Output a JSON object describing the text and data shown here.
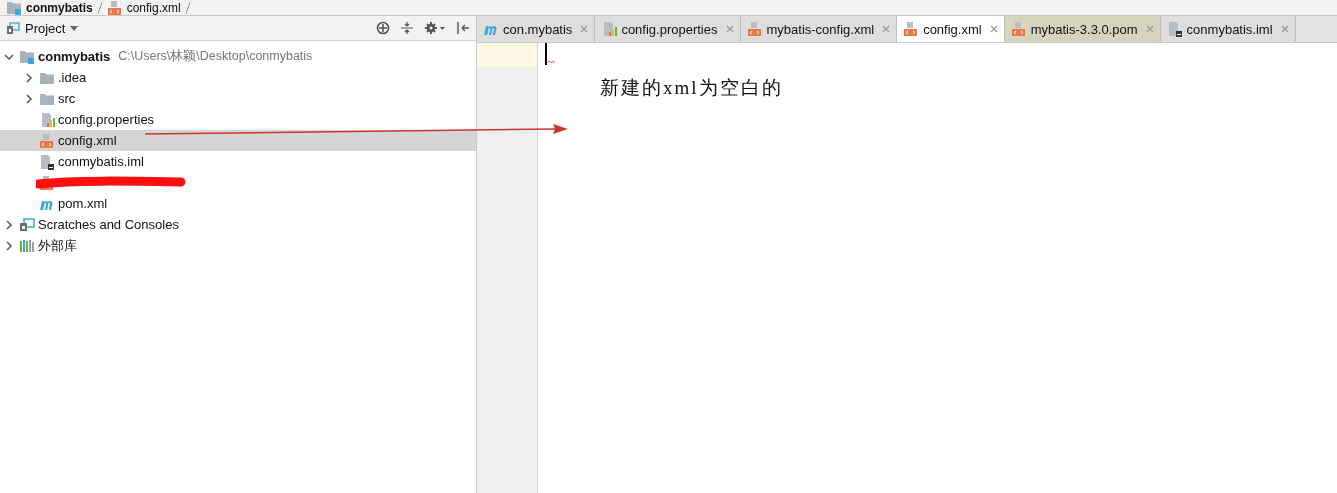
{
  "breadcrumb": [
    {
      "label": "conmybatis",
      "kind": "module"
    },
    {
      "label": "config.xml",
      "kind": "xml"
    }
  ],
  "project_panel": {
    "title": "Project"
  },
  "tree": [
    {
      "label": "conmybatis",
      "path": "C:\\Users\\林颖\\Desktop\\conmybatis",
      "kind": "module",
      "expanded": true,
      "selected": false,
      "children": [
        {
          "label": ".idea",
          "kind": "folder",
          "expanded": false,
          "selected": false
        },
        {
          "label": "src",
          "kind": "folder",
          "expanded": false,
          "selected": false
        },
        {
          "label": "config.properties",
          "kind": "properties",
          "selected": false
        },
        {
          "label": "config.xml",
          "kind": "xml",
          "selected": true
        },
        {
          "label": "conmybatis.iml",
          "kind": "iml",
          "selected": false
        },
        {
          "kind": "redacted",
          "selected": false
        },
        {
          "label": "pom.xml",
          "kind": "maven",
          "selected": false
        }
      ]
    },
    {
      "label": "Scratches and Consoles",
      "kind": "scratches",
      "expanded": false,
      "selected": false
    },
    {
      "label": "外部库",
      "kind": "library",
      "expanded": false,
      "selected": false
    }
  ],
  "tabs": [
    {
      "label": "con.mybatis",
      "kind": "maven",
      "selected": false,
      "shaded": false
    },
    {
      "label": "config.properties",
      "kind": "properties",
      "selected": false,
      "shaded": false
    },
    {
      "label": "mybatis-config.xml",
      "kind": "xml",
      "selected": false,
      "shaded": false
    },
    {
      "label": "config.xml",
      "kind": "xml",
      "selected": true,
      "shaded": false
    },
    {
      "label": "mybatis-3.3.0.pom",
      "kind": "xml",
      "selected": false,
      "shaded": true
    },
    {
      "label": "conmybatis.iml",
      "kind": "iml",
      "selected": false,
      "shaded": false
    }
  ],
  "annotation": {
    "note": "新建的xml为空白的"
  }
}
